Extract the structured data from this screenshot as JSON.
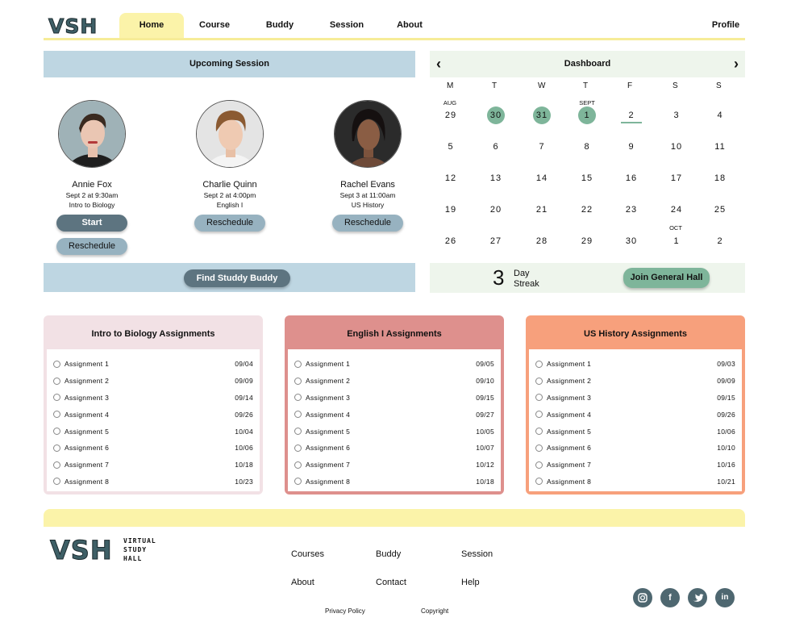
{
  "nav": {
    "logo": "VSH",
    "items": [
      "Home",
      "Course",
      "Buddy",
      "Session",
      "About"
    ],
    "profile": "Profile"
  },
  "session": {
    "title": "Upcoming Session",
    "people": [
      {
        "name": "Annie Fox",
        "time": "Sept 2 at 9:30am",
        "course": "Intro to Biology",
        "buttons": [
          "Start",
          "Reschedule"
        ]
      },
      {
        "name": "Charlie Quinn",
        "time": "Sept 2 at 4:00pm",
        "course": "English I",
        "buttons": [
          "Reschedule"
        ]
      },
      {
        "name": "Rachel Evans",
        "time": "Sept 3 at 11:00am",
        "course": "US History",
        "buttons": [
          "Reschedule"
        ]
      }
    ],
    "find_button": "Find Studdy Buddy"
  },
  "calendar": {
    "title": "Dashboard",
    "weekdays": [
      "M",
      "T",
      "W",
      "T",
      "F",
      "S",
      "S"
    ],
    "weeks": [
      [
        "29",
        "30",
        "31",
        "1",
        "2",
        "3",
        "4"
      ],
      [
        "5",
        "6",
        "7",
        "8",
        "9",
        "10",
        "11"
      ],
      [
        "12",
        "13",
        "14",
        "15",
        "16",
        "17",
        "18"
      ],
      [
        "19",
        "20",
        "21",
        "22",
        "23",
        "24",
        "25"
      ],
      [
        "26",
        "27",
        "28",
        "29",
        "30",
        "1",
        "2"
      ]
    ],
    "month_labels": {
      "aug": "AUG",
      "sept": "SEPT",
      "oct": "OCT"
    },
    "highlighted": [
      "30",
      "31",
      "1"
    ],
    "today": "2",
    "streak_count": "3",
    "streak_label_1": "Day",
    "streak_label_2": "Streak",
    "join_button": "Join General Hall",
    "colors": {
      "highlight": "#7eb59a"
    }
  },
  "assignments": [
    {
      "title": "Intro to Biology Assignments",
      "color": "#f2e1e5",
      "items": [
        {
          "label": "Assignment 1",
          "due": "09/04"
        },
        {
          "label": "Assignment 2",
          "due": "09/09"
        },
        {
          "label": "Assignment 3",
          "due": "09/14"
        },
        {
          "label": "Assignment 4",
          "due": "09/26"
        },
        {
          "label": "Assignment 5",
          "due": "10/04"
        },
        {
          "label": "Assignment 6",
          "due": "10/06"
        },
        {
          "label": "Assignment 7",
          "due": "10/18"
        },
        {
          "label": "Assignment 8",
          "due": "10/23"
        }
      ]
    },
    {
      "title": "English I Assignments",
      "color": "#de908d",
      "items": [
        {
          "label": "Assignment 1",
          "due": "09/05"
        },
        {
          "label": "Assignment 2",
          "due": "09/10"
        },
        {
          "label": "Assignment 3",
          "due": "09/15"
        },
        {
          "label": "Assignment 4",
          "due": "09/27"
        },
        {
          "label": "Assignment 5",
          "due": "10/05"
        },
        {
          "label": "Assignment 6",
          "due": "10/07"
        },
        {
          "label": "Assignment 7",
          "due": "10/12"
        },
        {
          "label": "Assignment 8",
          "due": "10/18"
        }
      ]
    },
    {
      "title": "US History Assignments",
      "color": "#f7a07c",
      "items": [
        {
          "label": "Assignment 1",
          "due": "09/03"
        },
        {
          "label": "Assignment 2",
          "due": "09/09"
        },
        {
          "label": "Assignment 3",
          "due": "09/15"
        },
        {
          "label": "Assignment 4",
          "due": "09/26"
        },
        {
          "label": "Assignment 5",
          "due": "10/06"
        },
        {
          "label": "Assignment 6",
          "due": "10/10"
        },
        {
          "label": "Assignment 7",
          "due": "10/16"
        },
        {
          "label": "Assignment 8",
          "due": "10/21"
        }
      ]
    }
  ],
  "footer": {
    "logo": "VSH",
    "tagline": [
      "VIRTUAL",
      "STUDY",
      "HALL"
    ],
    "links": [
      "Courses",
      "Buddy",
      "Session",
      "About",
      "Contact",
      "Help"
    ],
    "privacy": "Privacy Policy",
    "copyright": "Copyright",
    "social": [
      "instagram-icon",
      "facebook-icon",
      "twitter-icon",
      "linkedin-icon"
    ]
  }
}
